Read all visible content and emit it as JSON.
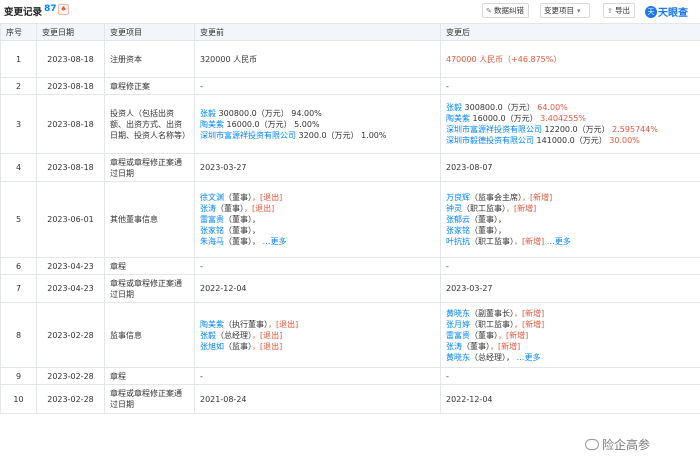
{
  "header": {
    "title": "变更记录",
    "count": "87",
    "bell": "♠",
    "btn_data": "数据纠错",
    "btn_filter": "变更项目",
    "btn_export": "导出",
    "logo_badge": "天",
    "logo_text": "天眼查"
  },
  "columns": {
    "num": "序号",
    "date": "变更日期",
    "item": "变更项目",
    "before": "变更前",
    "after": "变更后"
  },
  "rows": [
    {
      "num": "1",
      "date": "2023-08-18",
      "item": "注册资本",
      "before": "320000 人民币",
      "after": "470000 人民币（+46.875%）"
    },
    {
      "num": "2",
      "date": "2023-08-18",
      "item": "章程修正案",
      "before": "-",
      "after": "-"
    },
    {
      "num": "3",
      "date": "2023-08-18",
      "item": "投资人（包括出资额、出资方式、出资日期、投资人名称等）",
      "before": [
        {
          "n": "张毅",
          "t": "300800.0（万元）",
          "p": "94.00%"
        },
        {
          "n": "陶美紫",
          "t": "16000.0（万元）",
          "p": "5.00%"
        },
        {
          "n": "深圳市富源祥投资有限公司",
          "t": "3200.0（万元）",
          "p": "1.00%"
        }
      ],
      "after": [
        {
          "n": "张毅",
          "t": "300800.0（万元）",
          "p": "64.00%"
        },
        {
          "n": "陶美紫",
          "t": "16000.0（万元）",
          "p": "3.404255%"
        },
        {
          "n": "深圳市富源祥投资有限公司",
          "t": "12200.0（万元）",
          "p": "2.595744%"
        },
        {
          "n": "深圳市毅德投资有限公司",
          "t": "141000.0（万元）",
          "p": "30.00%"
        }
      ]
    },
    {
      "num": "4",
      "date": "2023-08-18",
      "item": "章程或章程修正案通过日期",
      "before": "2023-03-27",
      "after": "2023-08-07"
    },
    {
      "num": "5",
      "date": "2023-06-01",
      "item": "其他董事信息",
      "before": [
        {
          "n": "徐文渊",
          "r": "（董事）",
          "tag": "[退出]"
        },
        {
          "n": "张涛",
          "r": "（董事）",
          "tag": "[退出]"
        },
        {
          "n": "雷富贵",
          "r": "（董事）"
        },
        {
          "n": "张家铭",
          "r": "（董事）"
        },
        {
          "n": "朱海马",
          "r": "（董事）",
          "more": "更多"
        }
      ],
      "after": [
        {
          "n": "万良辉",
          "r": "（监事会主席）",
          "tag": "[新增]"
        },
        {
          "n": "钟灵",
          "r": "（职工监事）",
          "tag": "[新增]"
        },
        {
          "n": "张郁云",
          "r": "（董事）"
        },
        {
          "n": "张家铭",
          "r": "（董事）"
        },
        {
          "n": "叶抗抗",
          "r": "（职工监事）",
          "tag": "[新增]",
          "more": "更多"
        }
      ]
    },
    {
      "num": "6",
      "date": "2023-04-23",
      "item": "章程",
      "before": "-",
      "after": "-"
    },
    {
      "num": "7",
      "date": "2023-04-23",
      "item": "章程或章程修正案通过日期",
      "before": "2022-12-04",
      "after": "2023-03-27"
    },
    {
      "num": "8",
      "date": "2023-02-28",
      "item": "监事信息",
      "before": [
        {
          "n": "陶美紫",
          "r": "（执行董事）",
          "tag": "[退出]"
        },
        {
          "n": "张毅",
          "r": "（总经理）",
          "tag": "[退出]"
        },
        {
          "n": "张旭如",
          "r": "（监事）",
          "tag": "[退出]"
        }
      ],
      "after": [
        {
          "n": "黄晓东",
          "r": "（副董事长）",
          "tag": "[新增]"
        },
        {
          "n": "张月婷",
          "r": "（职工监事）",
          "tag": "[新增]"
        },
        {
          "n": "雷富贵",
          "r": "（董事）",
          "tag": "[新增]"
        },
        {
          "n": "张涛",
          "r": "（董事）",
          "tag": "[新增]"
        },
        {
          "n": "黄晓东",
          "r": "（总经理）",
          "more": "更多"
        }
      ]
    },
    {
      "num": "9",
      "date": "2023-02-28",
      "item": "章程",
      "before": "-",
      "after": "-"
    },
    {
      "num": "10",
      "date": "2023-02-28",
      "item": "章程或章程修正案通过日期",
      "before": "2021-08-24",
      "after": "2022-12-04"
    }
  ],
  "watermark": "险企高参"
}
